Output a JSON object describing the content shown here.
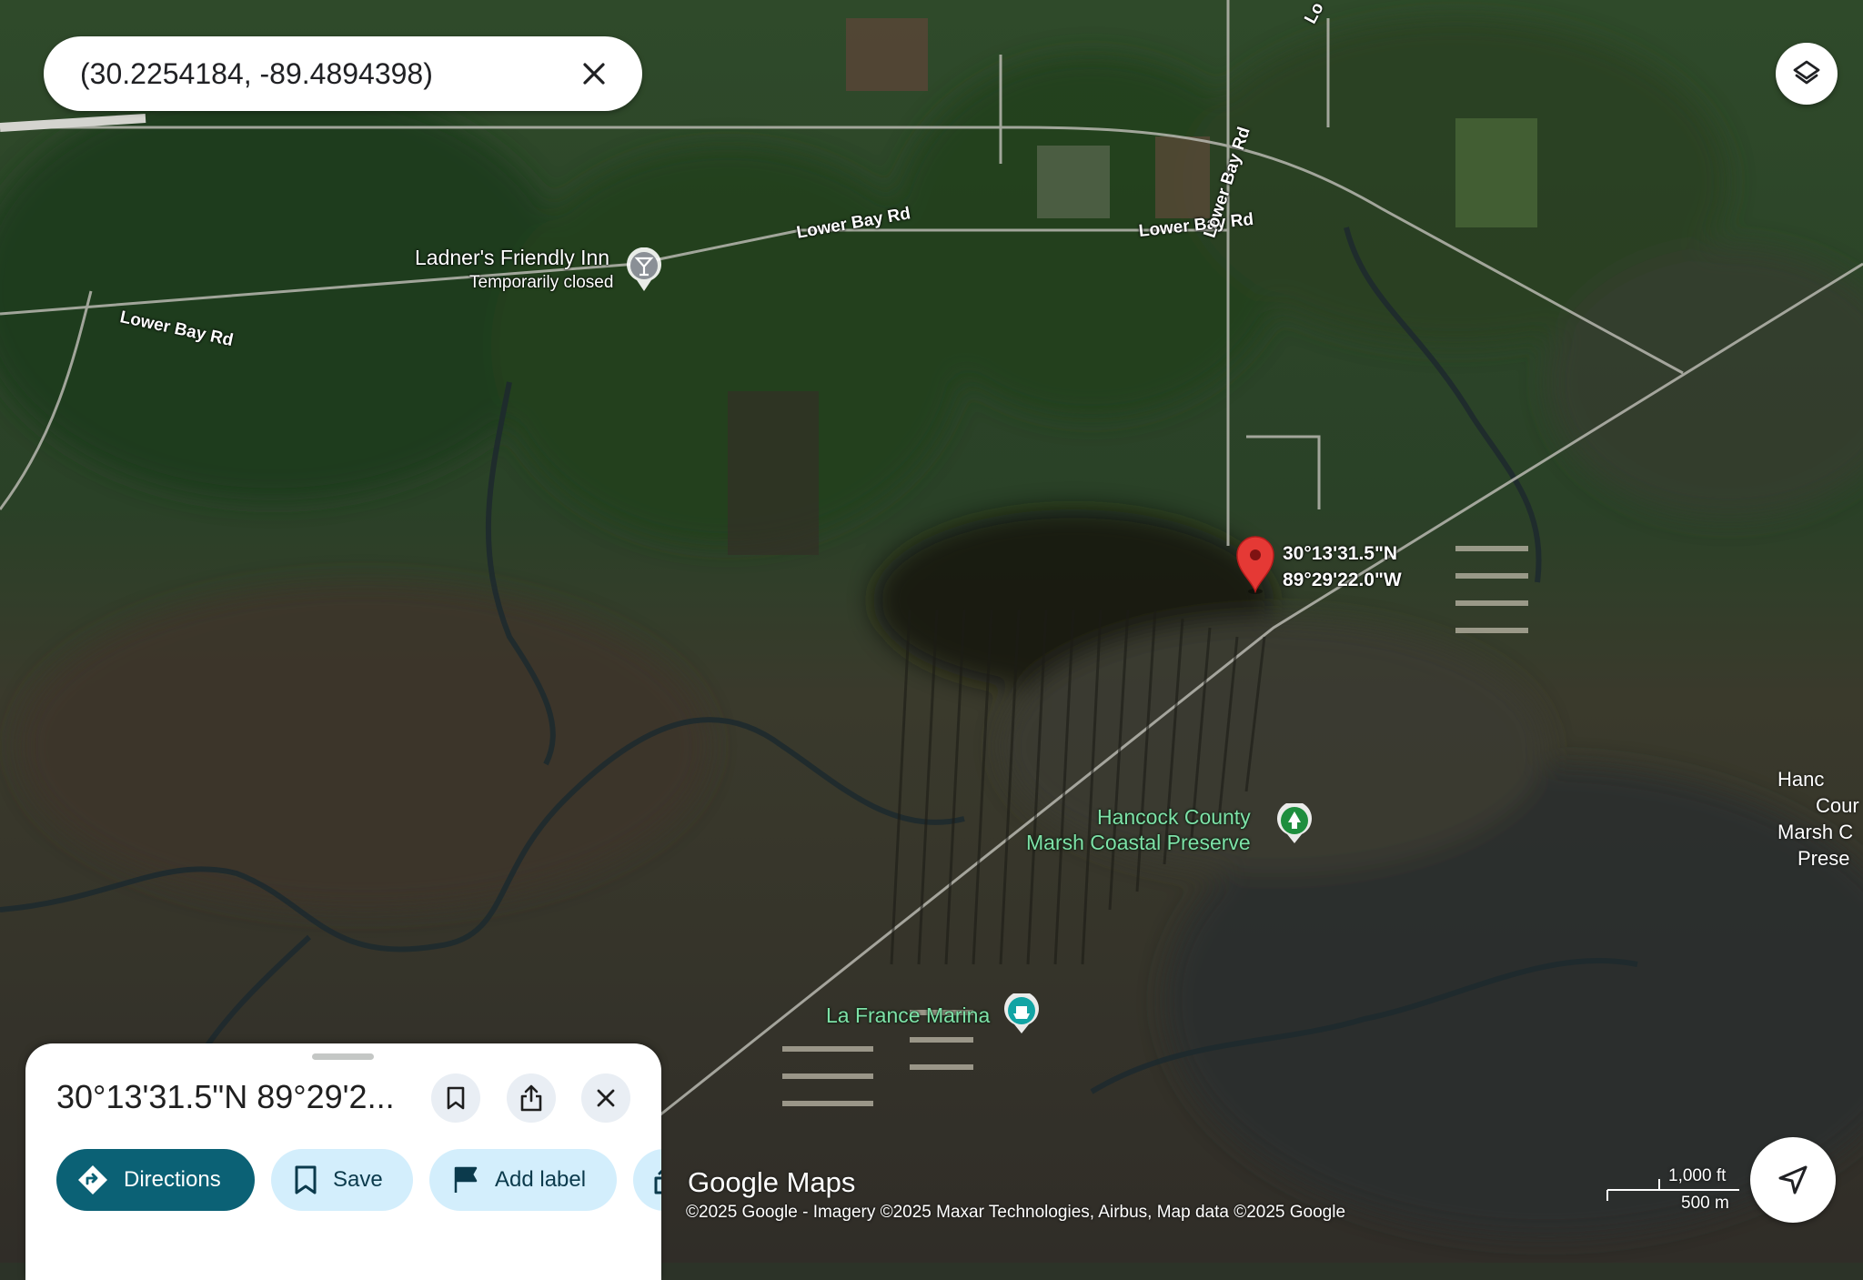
{
  "search": {
    "query": "(30.2254184, -89.4894398)"
  },
  "map": {
    "pois": {
      "inn_name": "Ladner's Friendly Inn",
      "inn_status": "Temporarily closed",
      "preserve_line1": "Hancock County",
      "preserve_line2": "Marsh Coastal Preserve",
      "marina": "La France Marina",
      "edge_preserve": [
        "Hanc",
        "Cour",
        "Marsh C",
        "Prese"
      ]
    },
    "roads": {
      "a": "Lower Bay Rd",
      "b": "Lower Bay Rd",
      "c": "Lower Bay Rd",
      "d": "Lower Bay Rd",
      "top": "Lo"
    },
    "pin": {
      "lat": "30°13'31.5\"N",
      "lng": "89°29'22.0\"W",
      "color": "#e53935"
    }
  },
  "sheet": {
    "title": "30°13'31.5\"N 89°29'2...",
    "chips": {
      "directions": "Directions",
      "save": "Save",
      "add_label": "Add label"
    }
  },
  "footer": {
    "logo": "Google Maps",
    "attribution": "©2025 Google - Imagery ©2025 Maxar Technologies, Airbus, Map data ©2025 Google",
    "scale_ft": "1,000 ft",
    "scale_m": "500 m"
  },
  "colors": {
    "primary": "#0b6175",
    "tonal": "#d3eefc",
    "poi_green": "#7ee2a8"
  }
}
